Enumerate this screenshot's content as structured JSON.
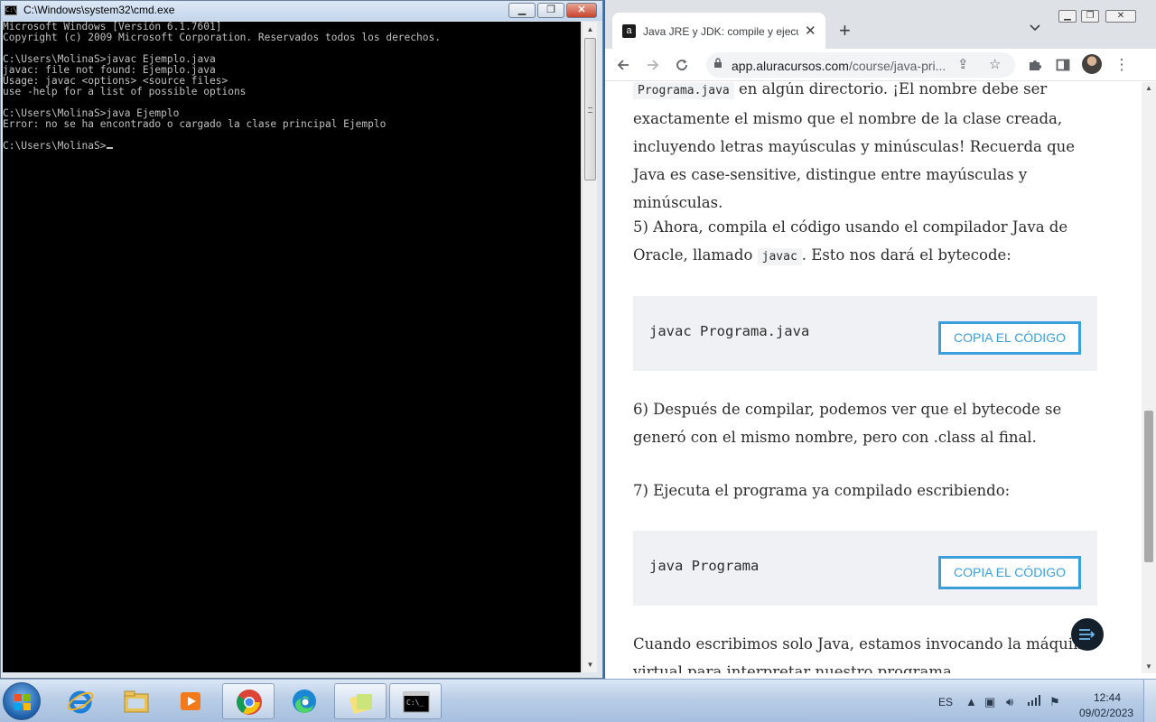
{
  "cmd": {
    "title": "C:\\Windows\\system32\\cmd.exe",
    "icon_label": "C:\\",
    "lines": [
      "Microsoft Windows [Versión 6.1.7601]",
      "Copyright (c) 2009 Microsoft Corporation. Reservados todos los derechos.",
      "",
      "C:\\Users\\MolinaS>javac Ejemplo.java",
      "javac: file not found: Ejemplo.java",
      "Usage: javac <options> <source files>",
      "use -help for a list of possible options",
      "",
      "C:\\Users\\MolinaS>java Ejemplo",
      "Error: no se ha encontrado o cargado la clase principal Ejemplo",
      "",
      "C:\\Users\\MolinaS>"
    ]
  },
  "chrome": {
    "tab_title": "Java JRE y JDK: compile y ejecute",
    "favicon": "a",
    "url_domain": "app.aluracursos.com",
    "url_path": "/course/java-pri...",
    "icons": {
      "back": "arrow-left-icon",
      "forward": "arrow-right-icon",
      "reload": "reload-icon",
      "lock": "lock-icon",
      "share": "share-icon",
      "star": "star-icon",
      "extensions": "puzzle-icon",
      "sidepanel": "side-panel-icon",
      "menu": "kebab-menu-icon"
    }
  },
  "article": {
    "p1_code": "Programa.java",
    "p1_text": " en algún directorio. ¡El nombre debe ser exactamente el mismo que el nombre de la clase creada, incluyendo letras mayúsculas y minúsculas! Recuerda que Java es case-sensitive, distingue entre mayúsculas y minúsculas.",
    "p2_pre": "5) Ahora, compila el código usando el compilador Java de Oracle, llamado ",
    "p2_code": "javac",
    "p2_post": ". Esto nos dará el bytecode:",
    "code1": "javac Programa.java",
    "copy_label": "COPIA EL CÓDIGO",
    "p3": "6) Después de compilar, podemos ver que el bytecode se generó con el mismo nombre, pero con .class al final.",
    "p4": "7) Ejecuta el programa ya compilado escribiendo:",
    "code2": "java Programa",
    "p5": "Cuando escribimos solo Java, estamos invocando la máquina virtual para interpretar nuestro programa."
  },
  "taskbar": {
    "language": "ES",
    "time": "12:44",
    "date": "09/02/2023",
    "apps": [
      "internet-explorer",
      "file-explorer",
      "media-player",
      "chrome",
      "edge",
      "sticky-notes",
      "cmd"
    ]
  }
}
